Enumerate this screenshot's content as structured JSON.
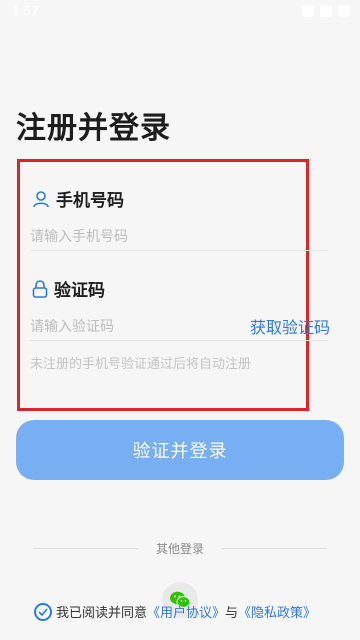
{
  "status_bar": {
    "time": "1:57"
  },
  "page": {
    "title": "注册并登录"
  },
  "form": {
    "phone": {
      "icon": "user-icon",
      "label": "手机号码",
      "placeholder": "请输入手机号码"
    },
    "code": {
      "icon": "lock-icon",
      "label": "验证码",
      "placeholder": "请输入验证码",
      "get_code_label": "获取验证码"
    },
    "hint": "未注册的手机号验证通过后将自动注册"
  },
  "login_button": {
    "label": "验证并登录",
    "color": "#78aef2"
  },
  "other_login": {
    "label": "其他登录",
    "wechat_icon": "wechat-icon",
    "wechat_color": "#2dc100"
  },
  "agreement": {
    "prefix": "我已阅读并同意",
    "user_agreement": "《用户协议》",
    "conjunction": "与",
    "privacy_policy": "《隐私政策》",
    "accent_color": "#2f79d8",
    "checked": true
  }
}
